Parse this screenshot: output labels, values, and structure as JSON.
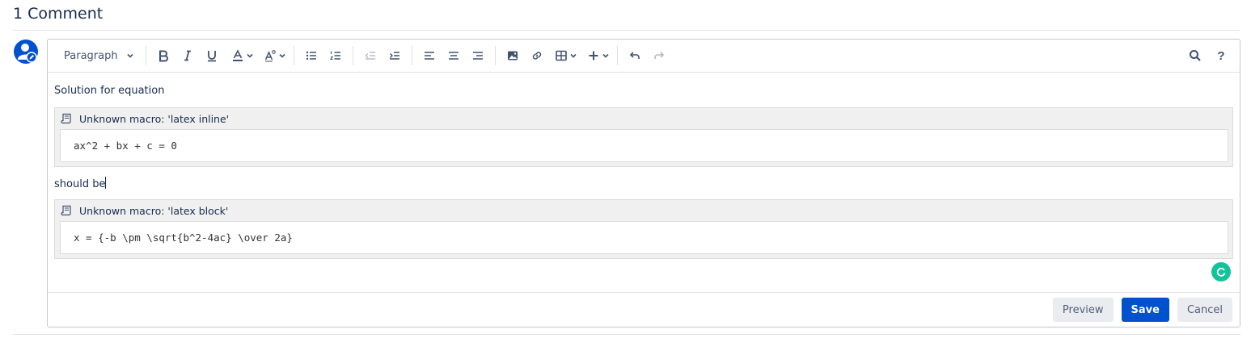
{
  "comments": {
    "title": "1 Comment"
  },
  "toolbar": {
    "paragraph_style": "Paragraph",
    "icons": [
      "bold-icon",
      "italic-icon",
      "underline-icon",
      "text-color-icon",
      "text-style-icon",
      "bullet-list-icon",
      "numbered-list-icon",
      "outdent-icon",
      "indent-icon",
      "align-left-icon",
      "align-center-icon",
      "align-right-icon",
      "image-icon",
      "link-icon",
      "table-icon",
      "insert-icon",
      "undo-icon",
      "redo-icon",
      "search-icon",
      "help-icon"
    ],
    "help_label": "?"
  },
  "editor": {
    "line1": "Solution for equation",
    "macro1": {
      "header": "Unknown macro: 'latex inline'",
      "body": "ax^2 + bx + c = 0"
    },
    "line2": "should be",
    "macro2": {
      "header": "Unknown macro: 'latex block'",
      "body": "x = {-b \\pm \\sqrt{b^2-4ac} \\over 2a}"
    }
  },
  "footer": {
    "preview": "Preview",
    "save": "Save",
    "cancel": "Cancel"
  },
  "colors": {
    "primary": "#0052cc",
    "grammarly": "#15c39a",
    "avatar": "#0052cc"
  }
}
